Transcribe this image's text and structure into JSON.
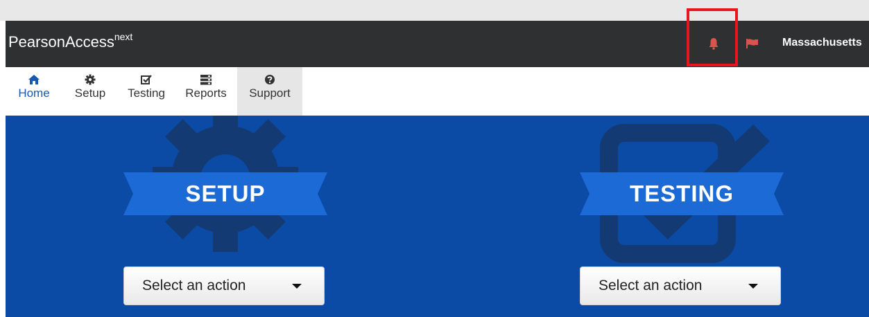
{
  "header": {
    "brand": "PearsonAccess",
    "brand_sup": "next",
    "state": "Massachusetts",
    "bell_icon": "bell-icon",
    "flag_icon": "flag-icon",
    "icon_color": "#d9534f"
  },
  "nav": {
    "items": [
      {
        "label": "Home",
        "icon": "home-icon"
      },
      {
        "label": "Setup",
        "icon": "gear-icon"
      },
      {
        "label": "Testing",
        "icon": "checkbox-icon"
      },
      {
        "label": "Reports",
        "icon": "reports-icon"
      },
      {
        "label": "Support",
        "icon": "question-circle-icon"
      }
    ]
  },
  "hero": {
    "setup": {
      "title": "SETUP",
      "select_label": "Select an action"
    },
    "testing": {
      "title": "TESTING",
      "select_label": "Select an action"
    }
  },
  "colors": {
    "topbar": "#2f3031",
    "hero": "#0b4aa5",
    "ribbon": "#1c6ad6",
    "highlight": "#e8141f"
  }
}
